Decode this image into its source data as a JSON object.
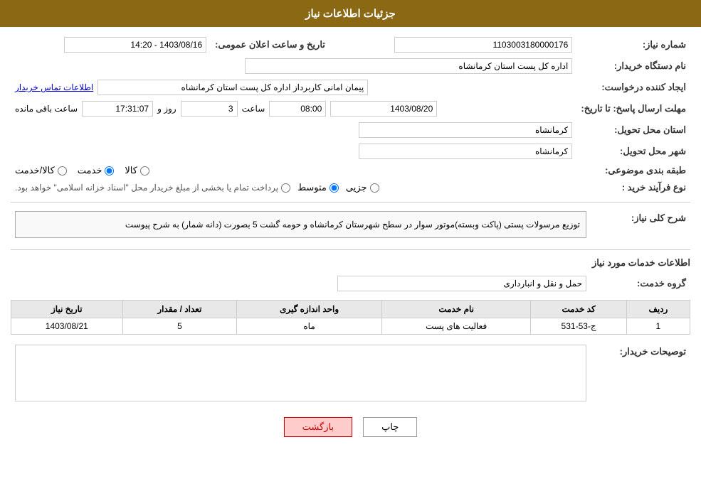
{
  "header": {
    "title": "جزئیات اطلاعات نیاز"
  },
  "fields": {
    "need_number_label": "شماره نیاز:",
    "need_number_value": "1103003180000176",
    "announce_date_label": "تاریخ و ساعت اعلان عمومی:",
    "announce_date_value": "1403/08/16 - 14:20",
    "buyer_org_label": "نام دستگاه خریدار:",
    "buyer_org_value": "اداره کل پست استان کرمانشاه",
    "creator_label": "ایجاد کننده درخواست:",
    "creator_value": "پیمان امانی کاربرداز اداره کل پست استان کرمانشاه",
    "creator_link": "اطلاعات تماس خریدار",
    "deadline_label": "مهلت ارسال پاسخ: تا تاریخ:",
    "deadline_date": "1403/08/20",
    "deadline_time_label": "ساعت",
    "deadline_time": "08:00",
    "deadline_days_label": "روز و",
    "deadline_days": "3",
    "deadline_remain_label": "ساعت باقی مانده",
    "deadline_remain": "17:31:07",
    "province_label": "استان محل تحویل:",
    "province_value": "کرمانشاه",
    "city_label": "شهر محل تحویل:",
    "city_value": "کرمانشاه",
    "category_label": "طبقه بندی موضوعی:",
    "category_options": [
      {
        "label": "کالا",
        "value": "kala"
      },
      {
        "label": "خدمت",
        "value": "khedmat",
        "checked": true
      },
      {
        "label": "کالا/خدمت",
        "value": "kala_khedmat"
      }
    ],
    "process_label": "نوع فرآیند خرید :",
    "process_options": [
      {
        "label": "جزیی",
        "value": "jozi"
      },
      {
        "label": "متوسط",
        "value": "motavasset",
        "checked": true
      },
      {
        "label": "پرداخت تمام یا بخشی از مبلغ خریدار محل \"اسناد خزانه اسلامی\" خواهد بود.",
        "value": "esnad"
      }
    ],
    "description_label": "شرح کلی نیاز:",
    "description_text": "توزیع مرسولات پستی (پاکت وبسته)موتور سوار در سطح شهرستان کرمانشاه و حومه گشت 5 بصورت (دانه شمار)  به شرح پیوست",
    "service_info_label": "اطلاعات خدمات مورد نیاز",
    "service_group_label": "گروه خدمت:",
    "service_group_value": "حمل و نقل و انبارداری",
    "table": {
      "columns": [
        "ردیف",
        "کد خدمت",
        "نام خدمت",
        "واحد اندازه گیری",
        "تعداد / مقدار",
        "تاریخ نیاز"
      ],
      "rows": [
        {
          "row": "1",
          "code": "ج-53-531",
          "name": "فعالیت های پست",
          "unit": "ماه",
          "qty": "5",
          "date": "1403/08/21"
        }
      ]
    },
    "buyer_notes_label": "توصیحات خریدار:"
  },
  "buttons": {
    "print": "چاپ",
    "back": "بازگشت"
  }
}
